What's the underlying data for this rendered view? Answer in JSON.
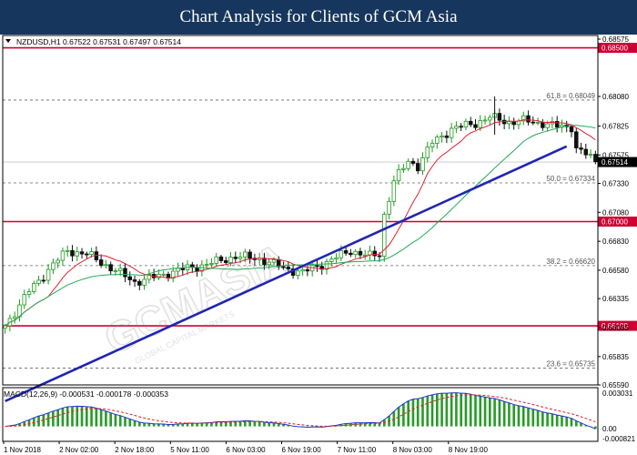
{
  "header": {
    "title": "Chart Analysis for Clients of GCM Asia"
  },
  "symbol_info": "NZDUSD,H1  0.67522 0.67531 0.67497 0.67514",
  "macd_info": "MACD(12,26,9) -0.000531 -0.000178 -0.000353",
  "watermark": "GCMASIA",
  "watermark_sub": "GLOBAL CAPITAL MARKETS",
  "chart_data": {
    "type": "candlestick",
    "symbol": "NZDUSD",
    "timeframe": "H1",
    "ylim": [
      0.6559,
      0.68575
    ],
    "y_ticks": [
      "0.68575",
      "0.68080",
      "0.67825",
      "0.67575",
      "0.67330",
      "0.67080",
      "0.66830",
      "0.66580",
      "0.66335",
      "0.66085",
      "0.65835",
      "0.65590"
    ],
    "x_ticks": [
      "1 Nov 2018",
      "2 Nov 02:00",
      "2 Nov 18:00",
      "5 Nov 11:00",
      "6 Nov 03:00",
      "6 Nov 19:00",
      "7 Nov 11:00",
      "8 Nov 03:00",
      "8 Nov 19:00"
    ],
    "price_levels": [
      {
        "label": "0.68500",
        "value": 0.685,
        "color": "#cc0033"
      },
      {
        "label": "0.67000",
        "value": 0.67,
        "color": "#cc0033"
      },
      {
        "label": "0.66100",
        "value": 0.661,
        "color": "#cc0033"
      }
    ],
    "fib_levels": [
      {
        "label": "61.8 = 0.68049",
        "value": 0.68049
      },
      {
        "label": "50.0 = 0.67334",
        "value": 0.67334
      },
      {
        "label": "38.2 = 0.66620",
        "value": 0.6662
      },
      {
        "label": "23.6 = 0.65735",
        "value": 0.65735
      }
    ],
    "current_price": "0.67514",
    "trendline": {
      "start": {
        "bar": 0,
        "price": 0.6545
      },
      "end": {
        "bar": 117,
        "price": 0.6765
      },
      "color": "#1f25b5"
    },
    "macd": {
      "ylim": [
        -0.00082,
        0.00303
      ],
      "ticks": [
        "0.003031",
        "0.00",
        "-0.000821"
      ]
    },
    "colors": {
      "up": "#1e9a1e",
      "down": "#111111",
      "ma_fast": "#dd2233",
      "ma_slow": "#22aa55",
      "trendline": "#1f25b5",
      "level": "#cc0033"
    }
  }
}
